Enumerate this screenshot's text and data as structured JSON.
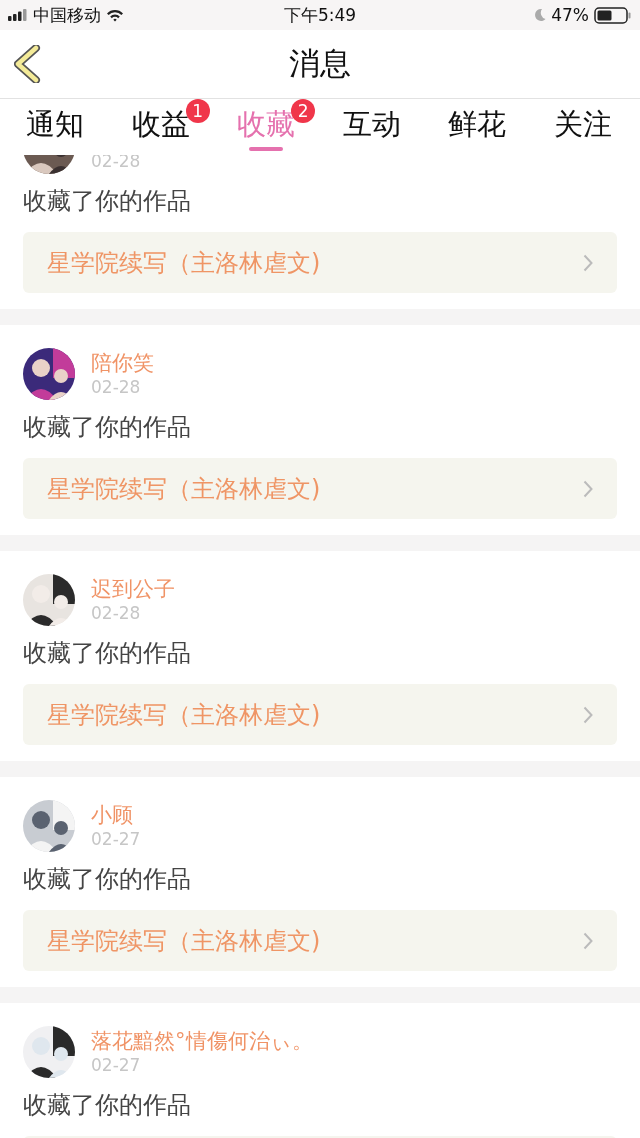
{
  "status_bar": {
    "carrier": "中国移动",
    "time": "下午5:49",
    "battery": "47%"
  },
  "nav": {
    "title": "消息"
  },
  "tabs": [
    {
      "label": "通知",
      "selected": false
    },
    {
      "label": "收益",
      "selected": false,
      "badge": "1"
    },
    {
      "label": "收藏",
      "selected": true,
      "badge": "2"
    },
    {
      "label": "互动",
      "selected": false
    },
    {
      "label": "鲜花",
      "selected": false
    },
    {
      "label": "关注",
      "selected": false
    }
  ],
  "messages": [
    {
      "date": "02-28",
      "action": "收藏了你的作品",
      "work": "星学院续写（主洛林虐文)"
    },
    {
      "name": "陪你笑",
      "date": "02-28",
      "action": "收藏了你的作品",
      "work": "星学院续写（主洛林虐文)"
    },
    {
      "name": "迟到公子",
      "date": "02-28",
      "action": "收藏了你的作品",
      "work": "星学院续写（主洛林虐文)"
    },
    {
      "name": "小顾",
      "date": "02-27",
      "action": "收藏了你的作品",
      "work": "星学院续写（主洛林虐文)"
    },
    {
      "name": "落花黯然°情傷何治ぃ。",
      "date": "02-27",
      "action": "收藏了你的作品"
    }
  ]
}
